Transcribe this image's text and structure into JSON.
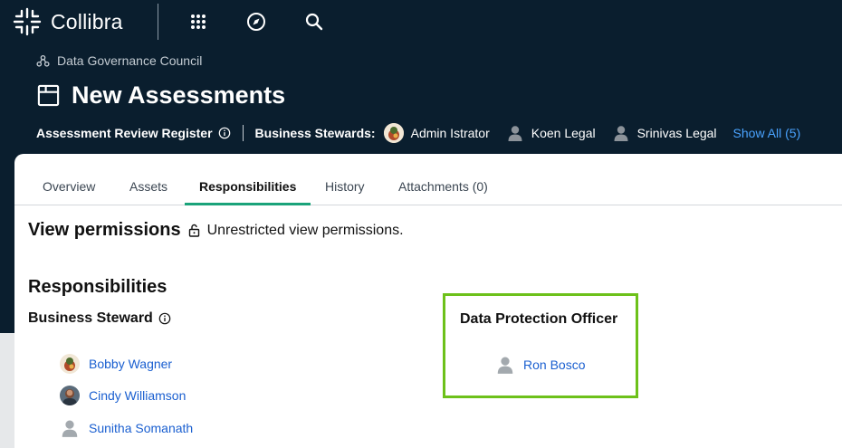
{
  "app": {
    "name": "Collibra"
  },
  "topbar": {
    "icons": [
      "apps-grid-icon",
      "compass-icon",
      "search-icon"
    ]
  },
  "header": {
    "community": "Data Governance Council",
    "title": "New Assessments",
    "domain_label": "Assessment Review Register",
    "stewards_label": "Business Stewards:",
    "stewards": [
      "Admin Istrator",
      "Koen Legal",
      "Srinivas Legal"
    ],
    "show_all": "Show All (5)"
  },
  "tabs": [
    {
      "label": "Overview",
      "active": false
    },
    {
      "label": "Assets",
      "active": false
    },
    {
      "label": "Responsibilities",
      "active": true
    },
    {
      "label": "History",
      "active": false
    },
    {
      "label": "Attachments (0)",
      "active": false
    }
  ],
  "view_permissions": {
    "title": "View permissions",
    "text": "Unrestricted view permissions."
  },
  "responsibilities": {
    "title": "Responsibilities",
    "business_steward": {
      "title": "Business Steward",
      "people": [
        "Bobby Wagner",
        "Cindy Williamson",
        "Sunitha Somanath"
      ]
    },
    "dpo": {
      "title": "Data Protection Officer",
      "people": [
        "Ron Bosco"
      ]
    }
  },
  "colors": {
    "topbar_bg": "#0a1e2e",
    "accent_tab": "#1aa37a",
    "link": "#1a5fd0",
    "highlight_border": "#6dc11a",
    "show_all": "#4aa3ff"
  }
}
